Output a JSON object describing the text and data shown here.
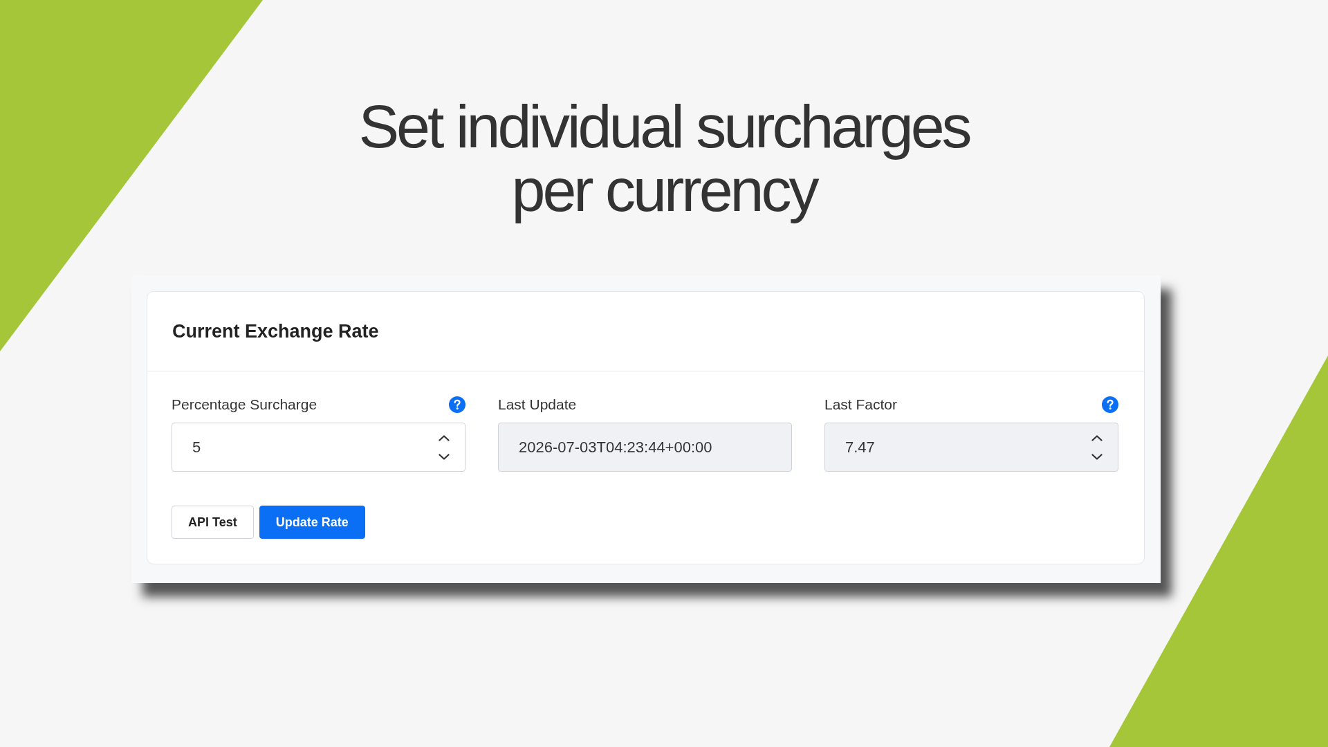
{
  "headline": "Set individual surcharges per currency",
  "card": {
    "title": "Current Exchange Rate",
    "fields": [
      {
        "kind": "number",
        "label": "Percentage Surcharge",
        "help": true,
        "value": "5",
        "disabled": false
      },
      {
        "kind": "text",
        "label": "Last Update",
        "help": false,
        "value": "2026-07-03T04:23:44+00:00",
        "disabled": true
      },
      {
        "kind": "number",
        "label": "Last Factor",
        "help": true,
        "value": "7.47",
        "disabled": true
      }
    ],
    "buttons": [
      {
        "kind": "secondary",
        "label": "API Test"
      },
      {
        "kind": "primary",
        "label": "Update Rate"
      }
    ]
  }
}
